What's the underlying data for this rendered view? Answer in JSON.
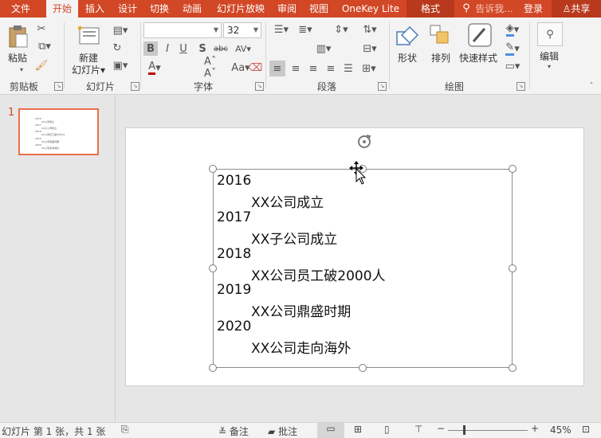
{
  "tabs": {
    "file": "文件",
    "home": "开始",
    "insert": "插入",
    "design": "设计",
    "transitions": "切换",
    "animations": "动画",
    "slideshow": "幻灯片放映",
    "review": "审阅",
    "view": "视图",
    "onekey": "OneKey Lite",
    "format": "格式",
    "tellme": "告诉我...",
    "login": "登录",
    "share": "共享"
  },
  "ribbon": {
    "clipboard": {
      "paste": "粘贴",
      "group": "剪贴板"
    },
    "slides": {
      "new_slide_1": "新建",
      "new_slide_2": "幻灯片",
      "group": "幻灯片"
    },
    "font": {
      "font_name": "",
      "font_size": "32",
      "group": "字体"
    },
    "paragraph": {
      "group": "段落"
    },
    "drawing": {
      "shapes": "形状",
      "arrange": "排列",
      "quick_styles": "快速样式",
      "group": "绘图"
    },
    "editing": {
      "edit": "编辑"
    }
  },
  "thumbnail": {
    "number": "1",
    "lines": [
      "2016",
      "XX公司成立",
      "2017",
      "XX子公司成立",
      "2018",
      "XX公司员工破2000人",
      "2019",
      "XX公司鼎盛时期",
      "2020",
      "XX公司走向海外"
    ]
  },
  "slide": {
    "lines": [
      {
        "year": "2016",
        "event": "XX公司成立"
      },
      {
        "year": "2017",
        "event": "XX子公司成立"
      },
      {
        "year": "2018",
        "event": "XX公司员工破2000人"
      },
      {
        "year": "2019",
        "event": "XX公司鼎盛时期"
      },
      {
        "year": "2020",
        "event": "XX公司走向海外"
      }
    ]
  },
  "status": {
    "slide_info": "幻灯片 第 1 张，共 1 张",
    "notes": "备注",
    "comments": "批注",
    "zoom": "45%"
  },
  "colors": {
    "accent": "#d24726",
    "thumb_border": "#e9704b",
    "format_tab": "#b8391c"
  }
}
